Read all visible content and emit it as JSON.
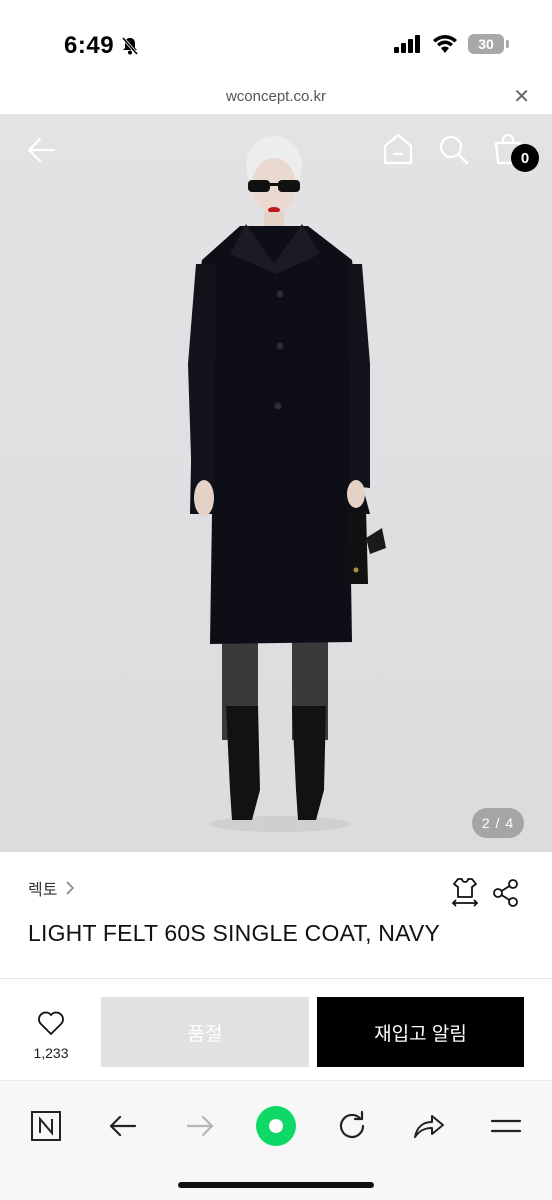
{
  "status_bar": {
    "time": "6:49",
    "battery": "30"
  },
  "url_bar": {
    "url": "wconcept.co.kr",
    "close_icon": "close-icon"
  },
  "header": {
    "back_icon": "arrow-left-icon",
    "home_icon": "home-icon",
    "search_icon": "search-icon",
    "cart_icon": "shopping-bag-icon",
    "cart_count": "0"
  },
  "hero": {
    "image_counter": "2 / 4",
    "image_index": 2,
    "image_total": 4
  },
  "product": {
    "brand": "렉토",
    "title": "LIGHT FELT 60S SINGLE COAT, NAVY",
    "size_icon": "size-guide-icon",
    "share_icon": "share-icon"
  },
  "actions": {
    "like_count": "1,233",
    "soldout_label": "품절",
    "restock_label": "재입고 알림"
  },
  "browser_nav": {
    "items": [
      "naver-icon",
      "back-icon",
      "forward-icon",
      "green-dot-icon",
      "refresh-icon",
      "share-icon",
      "menu-icon"
    ]
  },
  "colors": {
    "accent_green": "#0ed866",
    "button_black": "#000000",
    "soldout_gray": "#e1e1e1"
  }
}
